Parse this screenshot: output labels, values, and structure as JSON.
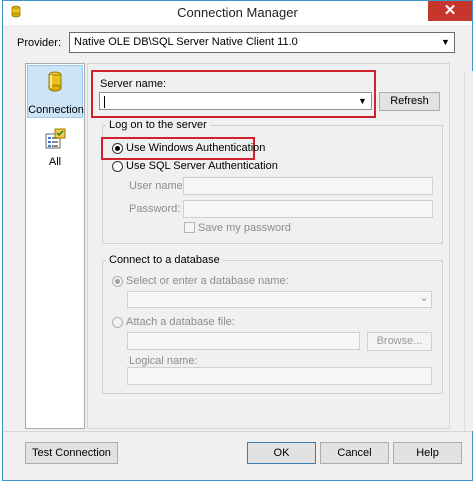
{
  "window": {
    "title": "Connection Manager",
    "close_glyph": "✕"
  },
  "provider": {
    "label": "Provider:",
    "value": "Native OLE DB\\SQL Server Native Client 11.0",
    "arrow": "▼"
  },
  "nav": {
    "items": [
      {
        "label": "Connection",
        "icon": "database-icon",
        "selected": true
      },
      {
        "label": "All",
        "icon": "properties-list-icon",
        "selected": false
      }
    ]
  },
  "server": {
    "label": "Server name:",
    "value": "",
    "refresh_label": "Refresh",
    "arrow": "▼"
  },
  "logon": {
    "group_label": "Log on to the server",
    "windows_auth_label": "Use Windows Authentication",
    "sql_auth_label": "Use SQL Server Authentication",
    "selected": "windows",
    "username_label": "User name:",
    "password_label": "Password:",
    "save_password_label": "Save my password"
  },
  "database": {
    "group_label": "Connect to a database",
    "select_db_label": "Select or enter a database name:",
    "attach_label": "Attach a database file:",
    "browse_label": "Browse...",
    "logical_name_label": "Logical name:",
    "arrow": "⌄"
  },
  "footer": {
    "test_connection_label": "Test Connection",
    "ok_label": "OK",
    "cancel_label": "Cancel",
    "help_label": "Help"
  },
  "colors": {
    "highlight": "#d4202c",
    "close": "#c7362c",
    "selection": "#cde4f7"
  }
}
